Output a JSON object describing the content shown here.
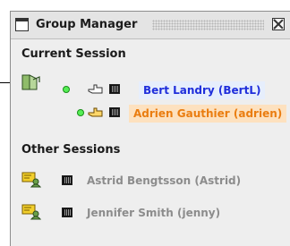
{
  "window": {
    "title": "Group Manager",
    "icon": "window-icon",
    "close_icon": "close-icon"
  },
  "current_session": {
    "header": "Current Session",
    "participants": [
      {
        "name": "Bert Landry (BertL)",
        "status_icon": "online-dot-icon",
        "hand_icon": "hand-outline-icon",
        "media_icon": "grid-icon",
        "highlight": "#1f2edb"
      },
      {
        "name": "Adrien Gauthier (adrien)",
        "status_icon": "online-dot-icon",
        "hand_icon": "hand-filled-icon",
        "media_icon": "grid-icon",
        "highlight": "#ea7d10"
      }
    ]
  },
  "other_sessions": {
    "header": "Other Sessions",
    "participants": [
      {
        "name": "Astrid Bengtsson (Astrid)",
        "icon": "chat-user-icon",
        "media_icon": "grid-icon"
      },
      {
        "name": "Jennifer Smith (jenny)",
        "icon": "chat-user-icon",
        "media_icon": "grid-icon"
      }
    ]
  },
  "colors": {
    "online": "#55ee55",
    "current_name": "#1f2edb",
    "other_name_disabled": "#8c8c8c",
    "highlight_orange": "#ea7d10"
  }
}
